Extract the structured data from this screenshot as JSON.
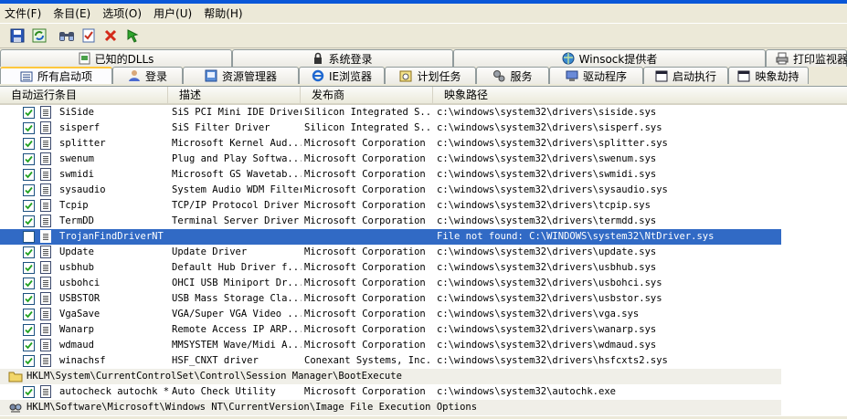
{
  "menu": [
    "文件(F)",
    "条目(E)",
    "选项(O)",
    "用户(U)",
    "帮助(H)"
  ],
  "toolbar": [
    "save-icon",
    "refresh-icon",
    "find-icon",
    "check-icon",
    "delete-icon",
    "jump-icon"
  ],
  "tabs_row1": [
    {
      "label": "已知的DLLs",
      "icon": "dll-icon"
    },
    {
      "label": "系统登录",
      "icon": "logon-icon"
    },
    {
      "label": "Winsock提供者",
      "icon": "winsock-icon"
    },
    {
      "label": "打印监视器",
      "icon": "printer-icon"
    }
  ],
  "tabs_row2": [
    {
      "label": "所有启动项",
      "icon": "all-icon",
      "active": true
    },
    {
      "label": "登录",
      "icon": "logon-icon"
    },
    {
      "label": "资源管理器",
      "icon": "explorer-icon"
    },
    {
      "label": "IE浏览器",
      "icon": "ie-icon"
    },
    {
      "label": "计划任务",
      "icon": "task-icon"
    },
    {
      "label": "服务",
      "icon": "services-icon"
    },
    {
      "label": "驱动程序",
      "icon": "drivers-icon"
    },
    {
      "label": "启动执行",
      "icon": "bootexec-icon"
    },
    {
      "label": "映象劫持",
      "icon": "hijack-icon"
    }
  ],
  "columns": [
    "自动运行条目",
    "描述",
    "发布商",
    "映象路径"
  ],
  "rows": [
    {
      "name": "SiSide",
      "desc": "SiS PCI Mini IDE Driver",
      "pub": "Silicon Integrated S...",
      "path": "c:\\windows\\system32\\drivers\\siside.sys"
    },
    {
      "name": "sisperf",
      "desc": "SiS Filter Driver",
      "pub": "Silicon Integrated S...",
      "path": "c:\\windows\\system32\\drivers\\sisperf.sys"
    },
    {
      "name": "splitter",
      "desc": "Microsoft Kernel Aud...",
      "pub": "Microsoft Corporation",
      "path": "c:\\windows\\system32\\drivers\\splitter.sys"
    },
    {
      "name": "swenum",
      "desc": "Plug and Play Softwa...",
      "pub": "Microsoft Corporation",
      "path": "c:\\windows\\system32\\drivers\\swenum.sys"
    },
    {
      "name": "swmidi",
      "desc": "Microsoft GS Wavetab...",
      "pub": "Microsoft Corporation",
      "path": "c:\\windows\\system32\\drivers\\swmidi.sys"
    },
    {
      "name": "sysaudio",
      "desc": "System Audio WDM Filter",
      "pub": "Microsoft Corporation",
      "path": "c:\\windows\\system32\\drivers\\sysaudio.sys"
    },
    {
      "name": "Tcpip",
      "desc": "TCP/IP Protocol Driver",
      "pub": "Microsoft Corporation",
      "path": "c:\\windows\\system32\\drivers\\tcpip.sys"
    },
    {
      "name": "TermDD",
      "desc": "Terminal Server Driver",
      "pub": "Microsoft Corporation",
      "path": "c:\\windows\\system32\\drivers\\termdd.sys"
    },
    {
      "name": "TrojanFindDriverNT",
      "desc": "",
      "pub": "",
      "path": "File not found: C:\\WINDOWS\\system32\\NtDriver.sys",
      "selected": true
    },
    {
      "name": "Update",
      "desc": "Update Driver",
      "pub": "Microsoft Corporation",
      "path": "c:\\windows\\system32\\drivers\\update.sys"
    },
    {
      "name": "usbhub",
      "desc": "Default Hub Driver f...",
      "pub": "Microsoft Corporation",
      "path": "c:\\windows\\system32\\drivers\\usbhub.sys"
    },
    {
      "name": "usbohci",
      "desc": "OHCI USB Miniport Dr...",
      "pub": "Microsoft Corporation",
      "path": "c:\\windows\\system32\\drivers\\usbohci.sys"
    },
    {
      "name": "USBSTOR",
      "desc": "USB Mass Storage Cla...",
      "pub": "Microsoft Corporation",
      "path": "c:\\windows\\system32\\drivers\\usbstor.sys"
    },
    {
      "name": "VgaSave",
      "desc": "VGA/Super VGA Video ...",
      "pub": "Microsoft Corporation",
      "path": "c:\\windows\\system32\\drivers\\vga.sys"
    },
    {
      "name": "Wanarp",
      "desc": "Remote Access IP ARP...",
      "pub": "Microsoft Corporation",
      "path": "c:\\windows\\system32\\drivers\\wanarp.sys"
    },
    {
      "name": "wdmaud",
      "desc": "MMSYSTEM Wave/Midi A...",
      "pub": "Microsoft Corporation",
      "path": "c:\\windows\\system32\\drivers\\wdmaud.sys"
    },
    {
      "name": "winachsf",
      "desc": "HSF_CNXT driver",
      "pub": "Conexant Systems, Inc.",
      "path": "c:\\windows\\system32\\drivers\\hsfcxts2.sys"
    }
  ],
  "group1": "HKLM\\System\\CurrentControlSet\\Control\\Session Manager\\BootExecute",
  "group1_rows": [
    {
      "name": "autocheck autochk *",
      "desc": "Auto Check Utility",
      "pub": "Microsoft Corporation",
      "path": "c:\\windows\\system32\\autochk.exe"
    }
  ],
  "group2": "HKLM\\Software\\Microsoft\\Windows NT\\CurrentVersion\\Image File Execution Options",
  "colors": {
    "selection": "#316ac5",
    "check": "#21a121",
    "title": "#0a57d8",
    "face": "#ece9d8"
  }
}
